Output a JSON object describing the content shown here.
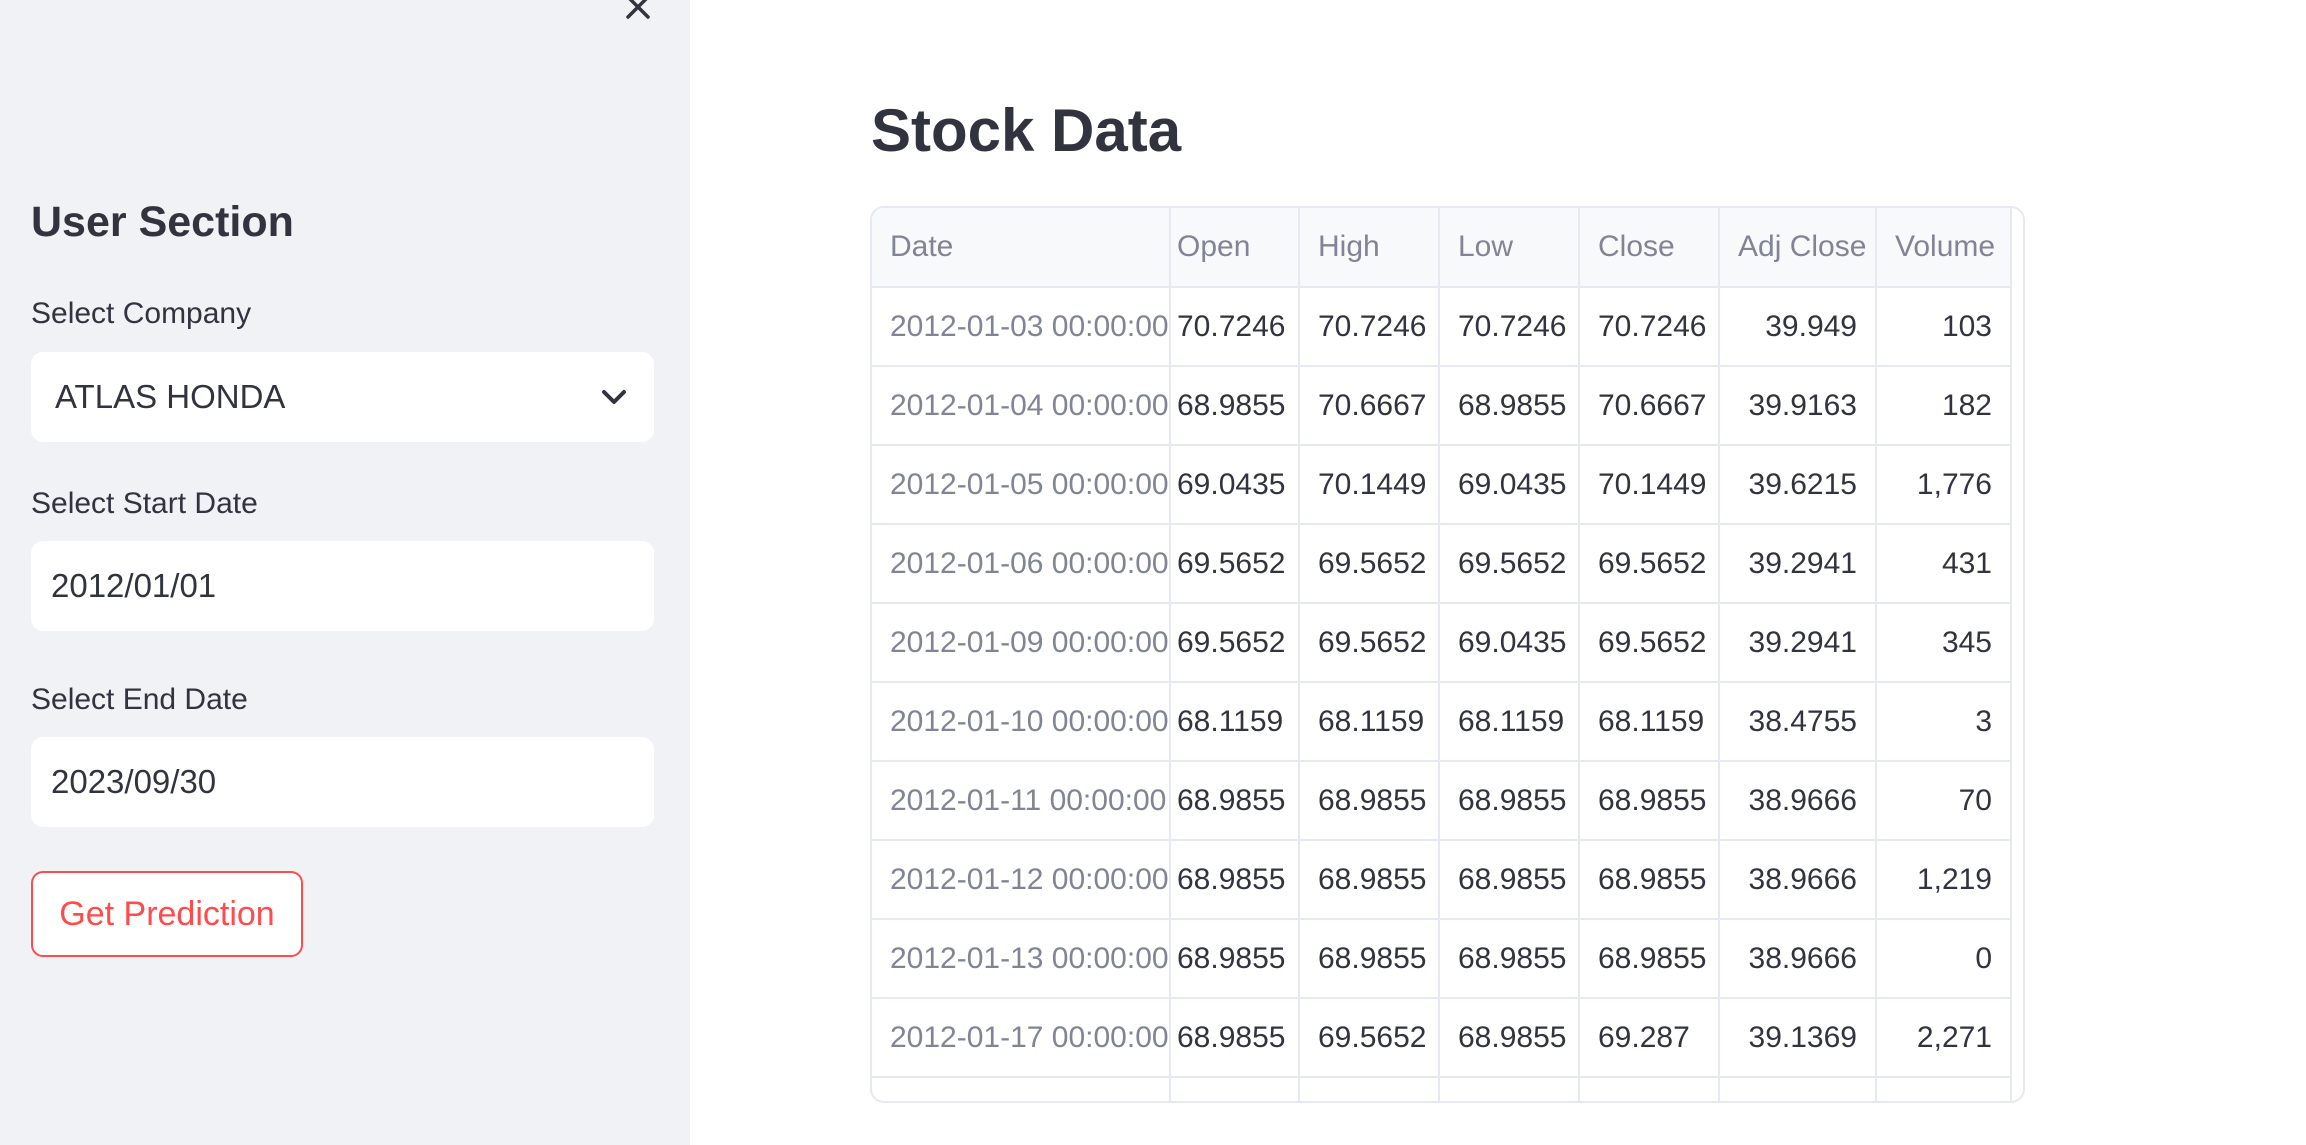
{
  "sidebar": {
    "title": "User Section",
    "company": {
      "label": "Select Company",
      "value": "ATLAS HONDA"
    },
    "start_date": {
      "label": "Select Start Date",
      "value": "2012/01/01"
    },
    "end_date": {
      "label": "Select End Date",
      "value": "2023/09/30"
    },
    "button_label": "Get Prediction"
  },
  "main": {
    "title": "Stock Data",
    "table": {
      "columns": [
        "Date",
        "Open",
        "High",
        "Low",
        "Close",
        "Adj Close",
        "Volume"
      ],
      "rows": [
        [
          "2012-01-03 00:00:00",
          "70.7246",
          "70.7246",
          "70.7246",
          "70.7246",
          "39.949",
          "103"
        ],
        [
          "2012-01-04 00:00:00",
          "68.9855",
          "70.6667",
          "68.9855",
          "70.6667",
          "39.9163",
          "182"
        ],
        [
          "2012-01-05 00:00:00",
          "69.0435",
          "70.1449",
          "69.0435",
          "70.1449",
          "39.6215",
          "1,776"
        ],
        [
          "2012-01-06 00:00:00",
          "69.5652",
          "69.5652",
          "69.5652",
          "69.5652",
          "39.2941",
          "431"
        ],
        [
          "2012-01-09 00:00:00",
          "69.5652",
          "69.5652",
          "69.0435",
          "69.5652",
          "39.2941",
          "345"
        ],
        [
          "2012-01-10 00:00:00",
          "68.1159",
          "68.1159",
          "68.1159",
          "68.1159",
          "38.4755",
          "3"
        ],
        [
          "2012-01-11 00:00:00",
          "68.9855",
          "68.9855",
          "68.9855",
          "68.9855",
          "38.9666",
          "70"
        ],
        [
          "2012-01-12 00:00:00",
          "68.9855",
          "68.9855",
          "68.9855",
          "68.9855",
          "38.9666",
          "1,219"
        ],
        [
          "2012-01-13 00:00:00",
          "68.9855",
          "68.9855",
          "68.9855",
          "68.9855",
          "38.9666",
          "0"
        ],
        [
          "2012-01-17 00:00:00",
          "68.9855",
          "69.5652",
          "68.9855",
          "69.287",
          "39.1369",
          "2,271"
        ]
      ]
    }
  },
  "icons": {
    "close": "close-icon",
    "dropdown": "chevron-down-icon"
  },
  "colors": {
    "accent": "#ff4b4b",
    "sidebar_bg": "#f0f2f6",
    "text": "#31333f",
    "muted": "#808495"
  }
}
